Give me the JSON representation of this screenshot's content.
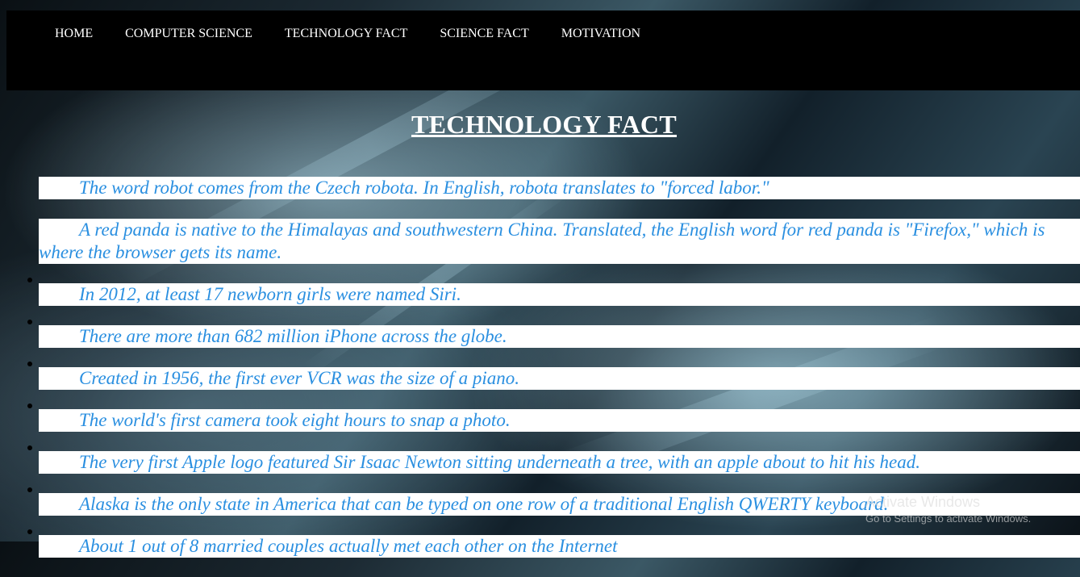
{
  "nav": {
    "items": [
      "HOME",
      "COMPUTER SCIENCE",
      "TECHNOLOGY FACT",
      "SCIENCE FACT",
      "MOTIVATION"
    ]
  },
  "page": {
    "title": "TECHNOLOGY FACT"
  },
  "facts": [
    "The word robot comes from the Czech robota. In English, robota translates to \"forced labor.\"",
    "A red panda is native to the Himalayas and southwestern China. Translated, the English word for red panda is \"Firefox,\" which is where the browser gets its name.",
    "In 2012, at least 17 newborn girls were named Siri.",
    "There are more than 682 million iPhone across the globe.",
    "Created in 1956, the first ever VCR was the size of a piano.",
    "The world's first camera took eight hours to snap a photo.",
    "The very first Apple logo featured Sir Isaac Newton sitting underneath a tree, with an apple about to hit his head.",
    "Alaska is the only state in America that can be typed on one row of a traditional English QWERTY keyboard.",
    "About 1 out of 8 married couples actually met each other on the Internet"
  ],
  "watermark": {
    "line1": "Activate Windows",
    "line2": "Go to Settings to activate Windows."
  },
  "colors": {
    "nav_bg": "#000000",
    "fact_text": "#2a8fe0",
    "fact_bg": "#ffffff"
  }
}
